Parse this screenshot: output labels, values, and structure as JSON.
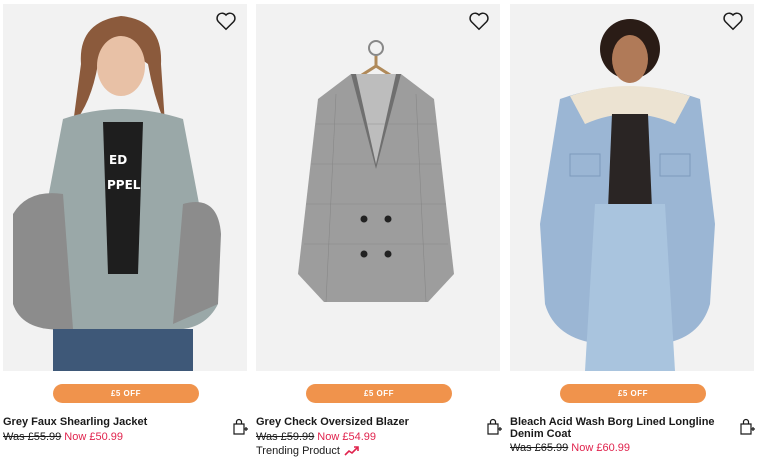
{
  "products": [
    {
      "name": "Grey Faux Shearling Jacket",
      "was": "Was £55.99",
      "now": "Now £50.99",
      "badge": "£5 OFF",
      "image_icon": "jacket-photo",
      "wishlist_icon": "heart-icon",
      "bag_icon": "add-to-bag-icon"
    },
    {
      "name": "Grey Check Oversized Blazer",
      "was": "Was £59.99",
      "now": "Now £54.99",
      "badge": "£5 OFF",
      "trending": "Trending Product",
      "image_icon": "blazer-photo",
      "wishlist_icon": "heart-icon",
      "bag_icon": "add-to-bag-icon"
    },
    {
      "name": "Bleach Acid Wash Borg Lined Longline Denim Coat",
      "was": "Was £65.99",
      "now": "Now £60.99",
      "badge": "£5 OFF",
      "image_icon": "denim-coat-photo",
      "wishlist_icon": "heart-icon",
      "bag_icon": "add-to-bag-icon"
    }
  ],
  "colors": {
    "badge": "#f0934c",
    "sale_price": "#e0234d",
    "trend_icon": "#e0234d"
  }
}
